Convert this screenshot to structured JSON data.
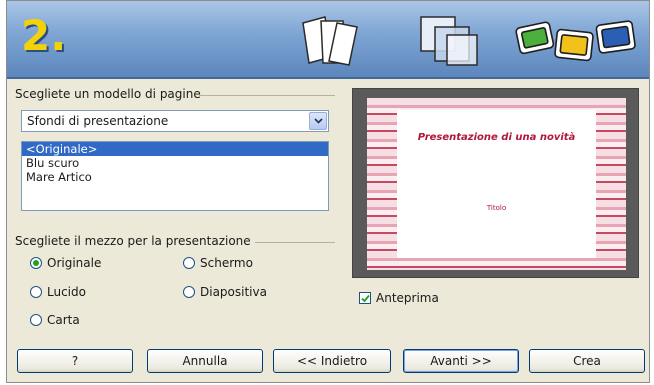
{
  "banner": {
    "step_number": "2."
  },
  "page_template": {
    "section_label": "Scegliete un modello di pagine",
    "category_selected": "Sfondi di presentazione",
    "templates": [
      {
        "label": "<Originale>",
        "selected": true
      },
      {
        "label": "Blu scuro",
        "selected": false
      },
      {
        "label": "Mare Artico",
        "selected": false
      }
    ]
  },
  "output_medium": {
    "section_label": "Scegliete il mezzo per la presentazione",
    "options": [
      {
        "label": "Originale",
        "checked": true
      },
      {
        "label": "Schermo",
        "checked": false
      },
      {
        "label": "Lucido",
        "checked": false
      },
      {
        "label": "Diapositiva",
        "checked": false
      },
      {
        "label": "Carta",
        "checked": false
      }
    ]
  },
  "preview": {
    "slide_title": "Presentazione di una novità",
    "slide_subtitle": "Titolo",
    "checkbox_label": "Anteprima",
    "checkbox_checked": true
  },
  "buttons": {
    "help": "?",
    "cancel": "Annulla",
    "back": "<< Indietro",
    "next": "Avanti >>",
    "create": "Crea"
  },
  "colors": {
    "selection": "#316ac5",
    "radio_dot": "#21a121",
    "accent_red": "#b01837",
    "step_number": "#f4d20a"
  }
}
